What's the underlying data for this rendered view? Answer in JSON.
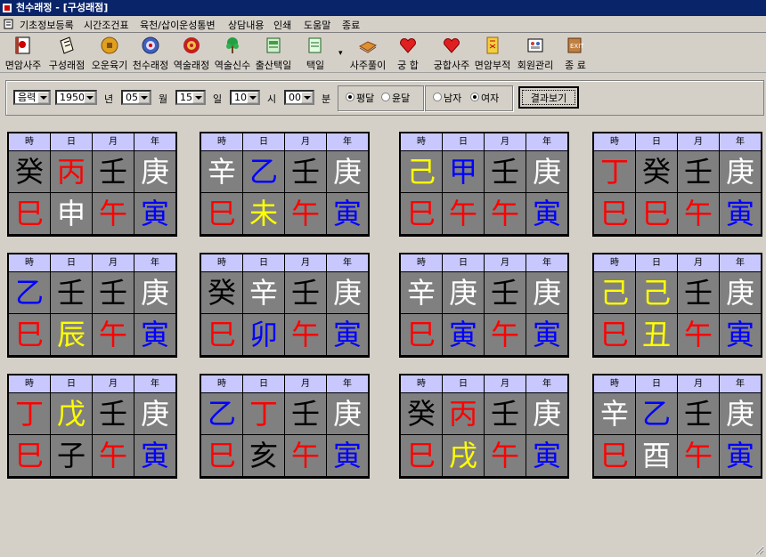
{
  "window": {
    "title": "천수래정 - [구성래점]"
  },
  "menu": [
    "기초정보등록",
    "시간조건표",
    "육천/삽이운성통변",
    "상담내용",
    "인쇄",
    "도움말",
    "종료"
  ],
  "toolbar": [
    {
      "label": "면암사주",
      "icon": "book-icon"
    },
    {
      "label": "구성래점",
      "icon": "scroll-icon"
    },
    {
      "label": "오운육기",
      "icon": "coin-icon"
    },
    {
      "label": "천수래정",
      "icon": "compass-icon"
    },
    {
      "label": "역술래정",
      "icon": "flower-icon"
    },
    {
      "label": "역술신수",
      "icon": "tree-icon"
    },
    {
      "label": "출산택일",
      "icon": "calendar-icon"
    },
    {
      "label": "택일",
      "icon": "pen-icon"
    },
    {
      "label": "사주풀이",
      "icon": "bread-icon"
    },
    {
      "label": "궁 합",
      "icon": "heart-icon"
    },
    {
      "label": "궁합사주",
      "icon": "heart-icon"
    },
    {
      "label": "면암부적",
      "icon": "talisman-icon"
    },
    {
      "label": "회원관리",
      "icon": "members-icon"
    },
    {
      "label": "종 료",
      "icon": "exit-icon"
    }
  ],
  "form": {
    "calendar": "음력",
    "year": "1950",
    "year_unit": "년",
    "month": "05",
    "month_unit": "월",
    "day": "15",
    "day_unit": "일",
    "hour": "10",
    "hour_unit": "시",
    "minute": "00",
    "minute_unit": "분",
    "month_type": {
      "options": [
        "평달",
        "윤달"
      ],
      "selected": "평달"
    },
    "gender": {
      "options": [
        "남자",
        "여자"
      ],
      "selected": "여자"
    },
    "submit": "결과보기"
  },
  "headers": [
    "時",
    "日",
    "月",
    "年"
  ],
  "colors": {
    "black": "#000000",
    "white": "#ffffff",
    "red": "#ff0000",
    "blue": "#0000ff",
    "yellow": "#ffff00",
    "header_bg": "#c8c8ff",
    "cell_bg": "#808080"
  },
  "cards": [
    {
      "stems": [
        {
          "c": "癸",
          "color": "black"
        },
        {
          "c": "丙",
          "color": "red"
        },
        {
          "c": "壬",
          "color": "black"
        },
        {
          "c": "庚",
          "color": "white"
        }
      ],
      "branches": [
        {
          "c": "巳",
          "color": "red"
        },
        {
          "c": "申",
          "color": "white"
        },
        {
          "c": "午",
          "color": "red"
        },
        {
          "c": "寅",
          "color": "blue"
        }
      ]
    },
    {
      "stems": [
        {
          "c": "辛",
          "color": "white"
        },
        {
          "c": "乙",
          "color": "blue"
        },
        {
          "c": "壬",
          "color": "black"
        },
        {
          "c": "庚",
          "color": "white"
        }
      ],
      "branches": [
        {
          "c": "巳",
          "color": "red"
        },
        {
          "c": "未",
          "color": "yellow"
        },
        {
          "c": "午",
          "color": "red"
        },
        {
          "c": "寅",
          "color": "blue"
        }
      ]
    },
    {
      "stems": [
        {
          "c": "己",
          "color": "yellow"
        },
        {
          "c": "甲",
          "color": "blue"
        },
        {
          "c": "壬",
          "color": "black"
        },
        {
          "c": "庚",
          "color": "white"
        }
      ],
      "branches": [
        {
          "c": "巳",
          "color": "red"
        },
        {
          "c": "午",
          "color": "red"
        },
        {
          "c": "午",
          "color": "red"
        },
        {
          "c": "寅",
          "color": "blue"
        }
      ]
    },
    {
      "stems": [
        {
          "c": "丁",
          "color": "red"
        },
        {
          "c": "癸",
          "color": "black"
        },
        {
          "c": "壬",
          "color": "black"
        },
        {
          "c": "庚",
          "color": "white"
        }
      ],
      "branches": [
        {
          "c": "巳",
          "color": "red"
        },
        {
          "c": "巳",
          "color": "red"
        },
        {
          "c": "午",
          "color": "red"
        },
        {
          "c": "寅",
          "color": "blue"
        }
      ]
    },
    {
      "stems": [
        {
          "c": "乙",
          "color": "blue"
        },
        {
          "c": "壬",
          "color": "black"
        },
        {
          "c": "壬",
          "color": "black"
        },
        {
          "c": "庚",
          "color": "white"
        }
      ],
      "branches": [
        {
          "c": "巳",
          "color": "red"
        },
        {
          "c": "辰",
          "color": "yellow"
        },
        {
          "c": "午",
          "color": "red"
        },
        {
          "c": "寅",
          "color": "blue"
        }
      ]
    },
    {
      "stems": [
        {
          "c": "癸",
          "color": "black"
        },
        {
          "c": "辛",
          "color": "white"
        },
        {
          "c": "壬",
          "color": "black"
        },
        {
          "c": "庚",
          "color": "white"
        }
      ],
      "branches": [
        {
          "c": "巳",
          "color": "red"
        },
        {
          "c": "卯",
          "color": "blue"
        },
        {
          "c": "午",
          "color": "red"
        },
        {
          "c": "寅",
          "color": "blue"
        }
      ]
    },
    {
      "stems": [
        {
          "c": "辛",
          "color": "white"
        },
        {
          "c": "庚",
          "color": "white"
        },
        {
          "c": "壬",
          "color": "black"
        },
        {
          "c": "庚",
          "color": "white"
        }
      ],
      "branches": [
        {
          "c": "巳",
          "color": "red"
        },
        {
          "c": "寅",
          "color": "blue"
        },
        {
          "c": "午",
          "color": "red"
        },
        {
          "c": "寅",
          "color": "blue"
        }
      ]
    },
    {
      "stems": [
        {
          "c": "己",
          "color": "yellow"
        },
        {
          "c": "己",
          "color": "yellow"
        },
        {
          "c": "壬",
          "color": "black"
        },
        {
          "c": "庚",
          "color": "white"
        }
      ],
      "branches": [
        {
          "c": "巳",
          "color": "red"
        },
        {
          "c": "丑",
          "color": "yellow"
        },
        {
          "c": "午",
          "color": "red"
        },
        {
          "c": "寅",
          "color": "blue"
        }
      ]
    },
    {
      "stems": [
        {
          "c": "丁",
          "color": "red"
        },
        {
          "c": "戊",
          "color": "yellow"
        },
        {
          "c": "壬",
          "color": "black"
        },
        {
          "c": "庚",
          "color": "white"
        }
      ],
      "branches": [
        {
          "c": "巳",
          "color": "red"
        },
        {
          "c": "子",
          "color": "black"
        },
        {
          "c": "午",
          "color": "red"
        },
        {
          "c": "寅",
          "color": "blue"
        }
      ]
    },
    {
      "stems": [
        {
          "c": "乙",
          "color": "blue"
        },
        {
          "c": "丁",
          "color": "red"
        },
        {
          "c": "壬",
          "color": "black"
        },
        {
          "c": "庚",
          "color": "white"
        }
      ],
      "branches": [
        {
          "c": "巳",
          "color": "red"
        },
        {
          "c": "亥",
          "color": "black"
        },
        {
          "c": "午",
          "color": "red"
        },
        {
          "c": "寅",
          "color": "blue"
        }
      ]
    },
    {
      "stems": [
        {
          "c": "癸",
          "color": "black"
        },
        {
          "c": "丙",
          "color": "red"
        },
        {
          "c": "壬",
          "color": "black"
        },
        {
          "c": "庚",
          "color": "white"
        }
      ],
      "branches": [
        {
          "c": "巳",
          "color": "red"
        },
        {
          "c": "戌",
          "color": "yellow"
        },
        {
          "c": "午",
          "color": "red"
        },
        {
          "c": "寅",
          "color": "blue"
        }
      ]
    },
    {
      "stems": [
        {
          "c": "辛",
          "color": "white"
        },
        {
          "c": "乙",
          "color": "blue"
        },
        {
          "c": "壬",
          "color": "black"
        },
        {
          "c": "庚",
          "color": "white"
        }
      ],
      "branches": [
        {
          "c": "巳",
          "color": "red"
        },
        {
          "c": "酉",
          "color": "white"
        },
        {
          "c": "午",
          "color": "red"
        },
        {
          "c": "寅",
          "color": "blue"
        }
      ]
    }
  ]
}
